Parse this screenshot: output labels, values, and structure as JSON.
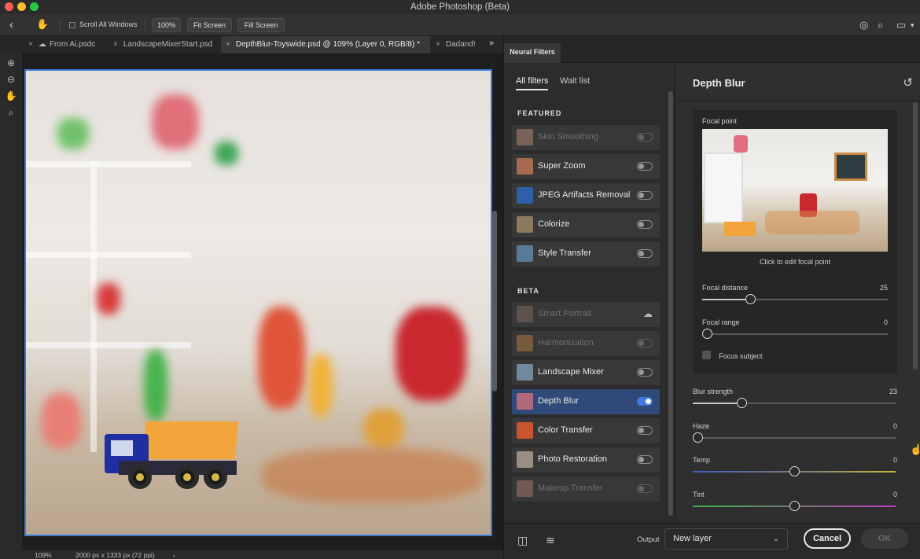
{
  "window": {
    "title": "Adobe Photoshop (Beta)"
  },
  "options": {
    "scroll_all_label": "Scroll All Windows",
    "zoom_button": "100%",
    "fit_button": "Fit Screen",
    "fill_button": "Fill Screen"
  },
  "tabs": [
    {
      "label": "From Ai.psdc",
      "icon": "cloud-icon"
    },
    {
      "label": "LandscapeMixerStart.psd"
    },
    {
      "label": "DepthBlur-Toyswide.psd @ 109% (Layer 0, RGB/8) *",
      "active": true
    },
    {
      "label": "Dadand!"
    }
  ],
  "status": {
    "zoom": "109%",
    "doc_info": "2000 px x 1333 px (72 ppi)"
  },
  "panel": {
    "tab": "Neural Filters",
    "list_tabs": [
      "All filters",
      "Wait list"
    ],
    "featured_title": "FEATURED",
    "beta_title": "BETA",
    "featured": [
      {
        "name": "Skin Smoothing",
        "enabled": false,
        "disabled": true
      },
      {
        "name": "Super Zoom",
        "enabled": false
      },
      {
        "name": "JPEG Artifacts Removal",
        "enabled": false
      },
      {
        "name": "Colorize",
        "enabled": false
      },
      {
        "name": "Style Transfer",
        "enabled": false
      }
    ],
    "beta": [
      {
        "name": "Smart Portrait",
        "disabled": true,
        "cloud": true
      },
      {
        "name": "Harmonization",
        "enabled": false,
        "disabled": true
      },
      {
        "name": "Landscape Mixer",
        "enabled": false
      },
      {
        "name": "Depth Blur",
        "enabled": true,
        "selected": true
      },
      {
        "name": "Color Transfer",
        "enabled": false
      },
      {
        "name": "Photo Restoration",
        "enabled": false
      },
      {
        "name": "Makeup Transfer",
        "enabled": false,
        "disabled": true
      }
    ]
  },
  "settings": {
    "title": "Depth Blur",
    "focal_point_label": "Focal point",
    "focal_point_caption": "Click to edit focal point",
    "focal_distance": {
      "label": "Focal distance",
      "value": "25"
    },
    "focal_range": {
      "label": "Focal range",
      "value": "0"
    },
    "focus_subject": "Focus subject",
    "blur_strength": {
      "label": "Blur strength",
      "value": "23"
    },
    "haze": {
      "label": "Haze",
      "value": "0"
    },
    "temp": {
      "label": "Temp",
      "value": "0"
    },
    "tint": {
      "label": "Tint",
      "value": "0"
    }
  },
  "footer": {
    "output_label": "Output",
    "output_value": "New layer",
    "cancel": "Cancel",
    "ok": "OK"
  },
  "colors": {
    "accent": "#3d7be0",
    "selection": "#2f4a78",
    "canvas_border": "#3b78d8"
  }
}
